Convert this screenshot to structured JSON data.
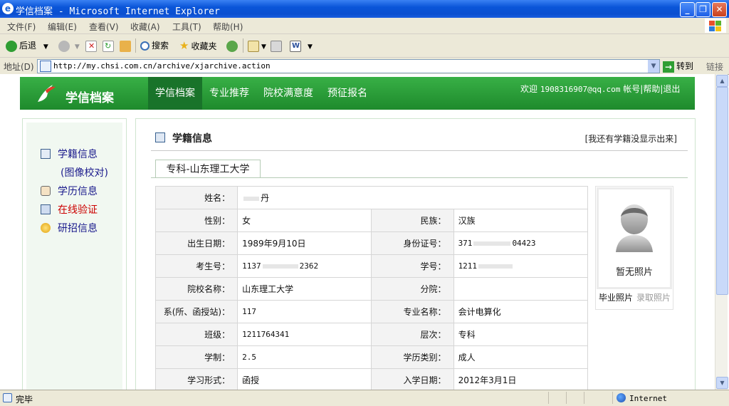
{
  "window": {
    "title": "学信档案 - Microsoft Internet Explorer",
    "min_glyph": "_",
    "max_glyph": "❐",
    "close_glyph": "✕"
  },
  "menubar": [
    "文件(F)",
    "编辑(E)",
    "查看(V)",
    "收藏(A)",
    "工具(T)",
    "帮助(H)"
  ],
  "toolbar": {
    "back": "后退",
    "search": "搜索",
    "favorites": "收藏夹"
  },
  "address": {
    "label": "地址(D)",
    "url": "http://my.chsi.com.cn/archive/xjarchive.action",
    "go": "转到",
    "links": "链接"
  },
  "site": {
    "name": "学信档案",
    "nav": [
      "学信档案",
      "专业推荐",
      "院校满意度",
      "预征报名"
    ],
    "welcome_prefix": "欢迎",
    "email": "1908316907@qq.com",
    "account": "帐号",
    "help": "帮助",
    "logout": "退出",
    "divider": "|"
  },
  "sidebar": {
    "items": [
      {
        "label": "学籍信息",
        "icon": "student-card-icon"
      },
      {
        "label": "(图像校对)",
        "icon": ""
      },
      {
        "label": "学历信息",
        "icon": "diploma-icon"
      },
      {
        "label": "在线验证",
        "icon": "verify-icon"
      },
      {
        "label": "研招信息",
        "icon": "medal-icon"
      }
    ]
  },
  "main": {
    "section_title": "学籍信息",
    "report_link": "[我还有学籍没显示出来]",
    "tab": "专科-山东理工大学",
    "fields": {
      "name_label": "姓名：",
      "name_value": "丹",
      "gender_label": "性别：",
      "gender_value": "女",
      "ethnicity_label": "民族：",
      "ethnicity_value": "汉族",
      "birth_label": "出生日期：",
      "birth_value": "1989年9月10日",
      "id_label": "身份证号：",
      "id_value_start": "371",
      "id_value_end": "04423",
      "exam_label": "考生号：",
      "exam_value_start": "1137",
      "exam_value_end": "2362",
      "studentno_label": "学号：",
      "studentno_value_start": "1211",
      "school_label": "院校名称：",
      "school_value": "山东理工大学",
      "campus_label": "分院：",
      "campus_value": "",
      "dept_label": "系(所、函授站)：",
      "dept_value": "117",
      "major_label": "专业名称：",
      "major_value": "会计电算化",
      "class_label": "班级：",
      "class_value": "1211764341",
      "level_label": "层次：",
      "level_value": "专科",
      "duration_label": "学制：",
      "duration_value": "2.5",
      "category_label": "学历类别：",
      "category_value": "成人",
      "form_label": "学习形式：",
      "form_value": "函授",
      "enroll_label": "入学日期：",
      "enroll_value": "2012年3月1日"
    },
    "photo": {
      "caption": "暂无照片",
      "tab_graduation": "毕业照片",
      "tab_enrollment": "录取照片"
    }
  },
  "statusbar": {
    "text": "完毕",
    "zone": "Internet"
  }
}
